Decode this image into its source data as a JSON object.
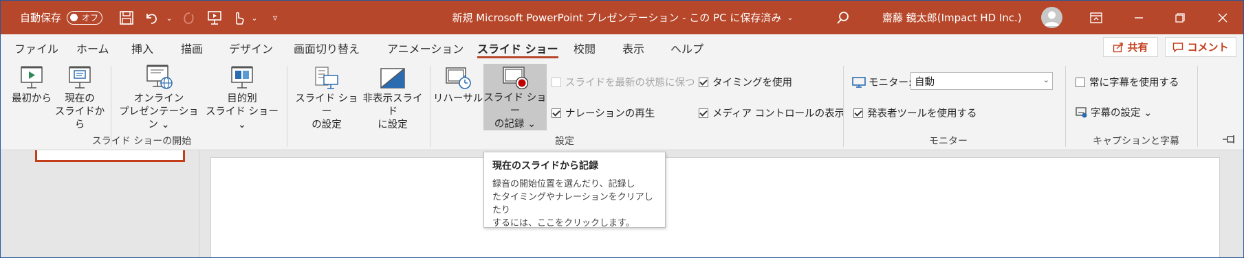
{
  "titlebar": {
    "autosave_label": "自動保存",
    "autosave_state": "オフ",
    "document_title": "新規 Microsoft PowerPoint プレゼンテーション - この PC に保存済み",
    "title_dropdown": "⌄",
    "user_name": "齋藤 鏡太郎(Impact HD Inc.)",
    "icons": [
      "save-icon",
      "undo-icon",
      "redo-icon",
      "present-icon",
      "touch-mode-icon",
      "customize-qat-icon",
      "search-icon",
      "ribbon-display-icon",
      "minimize-icon",
      "restore-icon",
      "close-icon"
    ]
  },
  "tabs": [
    {
      "label": "ファイル",
      "active": false
    },
    {
      "label": "ホーム",
      "active": false
    },
    {
      "label": "挿入",
      "active": false
    },
    {
      "label": "描画",
      "active": false
    },
    {
      "label": "デザイン",
      "active": false
    },
    {
      "label": "画面切り替え",
      "active": false
    },
    {
      "label": "アニメーション",
      "active": false
    },
    {
      "label": "スライド ショー",
      "active": true
    },
    {
      "label": "校閲",
      "active": false
    },
    {
      "label": "表示",
      "active": false
    },
    {
      "label": "ヘルプ",
      "active": false
    }
  ],
  "actions": {
    "share": "共有",
    "comment": "コメント"
  },
  "ribbon": {
    "start_group": {
      "label": "スライド ショーの開始",
      "from_beginning": "最初から",
      "from_current_1": "現在の",
      "from_current_2": "スライドから",
      "online_1": "オンライン",
      "online_2": "プレゼンテーション ⌄",
      "custom_1": "目的別",
      "custom_2": "スライド ショー ⌄"
    },
    "setup_group": {
      "label": "設定",
      "setup_1": "スライド ショー",
      "setup_2": "の設定",
      "hide_1": "非表示スライド",
      "hide_2": "に設定",
      "rehearse": "リハーサル",
      "record_1": "スライド ショー",
      "record_2": "の記録 ⌄",
      "keep_updated": "スライドを最新の状態に保つ",
      "keep_updated_checked": false,
      "play_narration": "ナレーションの再生",
      "play_narration_checked": true,
      "use_timings": "タイミングを使用",
      "use_timings_checked": true,
      "show_media_controls": "メディア コントロールの表示",
      "show_media_controls_checked": true
    },
    "monitor_group": {
      "label": "モニター",
      "monitor_label": "モニター:",
      "monitor_value": "自動",
      "presenter_view": "発表者ツールを使用する",
      "presenter_view_checked": true
    },
    "captions_group": {
      "label": "キャプションと字幕",
      "always_subtitles": "常に字幕を使用する",
      "always_subtitles_checked": false,
      "subtitle_settings": "字幕の設定 ⌄"
    }
  },
  "tooltip": {
    "title": "現在のスライドから記録",
    "line1": "録音の開始位置を選んだり、記録し",
    "line2": "たタイミングやナレーションをクリアしたり",
    "line3": "するには、ここをクリックします。"
  },
  "colors": {
    "accent": "#b7472a",
    "ribbon_bg": "#f3f3f3",
    "record_red": "#c00000"
  }
}
